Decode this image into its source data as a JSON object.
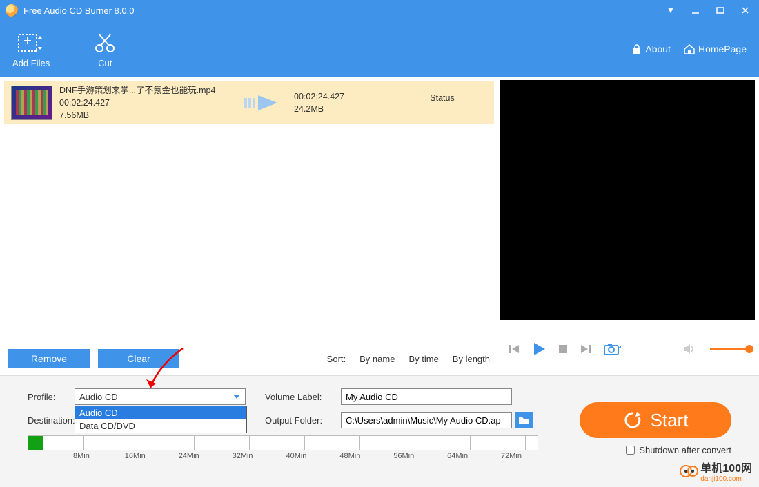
{
  "window": {
    "title": "Free Audio CD Burner 8.0.0"
  },
  "toolbar": {
    "add_files": "Add Files",
    "cut": "Cut",
    "about": "About",
    "homepage": "HomePage"
  },
  "file_row": {
    "name": "DNF手游策划来学...了不氪金也能玩.mp4",
    "duration_in": "00:02:24.427",
    "size_in": "7.56MB",
    "duration_out": "00:02:24.427",
    "size_out": "24.2MB",
    "status_header": "Status",
    "status_value": "-"
  },
  "list_actions": {
    "remove": "Remove",
    "clear": "Clear"
  },
  "sort": {
    "label": "Sort:",
    "by_name": "By name",
    "by_time": "By time",
    "by_length": "By length"
  },
  "form": {
    "profile_label": "Profile:",
    "profile_value": "Audio CD",
    "profile_options": [
      "Audio CD",
      "Data CD/DVD"
    ],
    "destination_label": "Destination:",
    "volume_label": "Volume Label:",
    "volume_value": "My Audio CD",
    "output_label": "Output Folder:",
    "output_value": "C:\\Users\\admin\\Music\\My Audio CD.ap"
  },
  "ruler": {
    "ticks": [
      "8Min",
      "16Min",
      "24Min",
      "32Min",
      "40Min",
      "48Min",
      "56Min",
      "64Min",
      "72Min"
    ]
  },
  "start": {
    "label": "Start"
  },
  "shutdown": {
    "label": "Shutdown after convert"
  },
  "watermark": {
    "main": "单机100网",
    "sub": "danji100.com"
  }
}
